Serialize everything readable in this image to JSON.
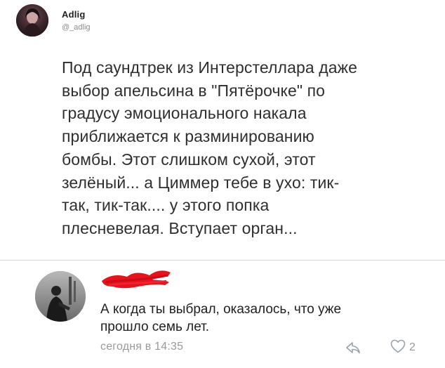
{
  "tweet": {
    "author_name": "Adlig",
    "author_handle": "@_adlig",
    "text": "Под саундтрек из Интерстеллара даже\nвыбор апельсина в \"Пятёрочке\" по\nградусу эмоционального накала\nприближается к разминированию\nбомбы. Этот слишком сухой, этот\nзелёный... а Циммер тебе в ухо: тик-\nтак, тик-так.... у этого попка\nплесневелая. Вступает орган..."
  },
  "comment": {
    "text": "А когда ты выбрал, оказалось, что уже\nпрошло семь лет.",
    "time": "сегодня в 14:35",
    "like_count": "2",
    "icons": {
      "reply": "reply-arrow-icon",
      "like": "heart-outline-icon"
    }
  },
  "colors": {
    "redaction": "#e8121d",
    "meta_text": "#9a9a9a",
    "separator": "#d6d6d6"
  }
}
